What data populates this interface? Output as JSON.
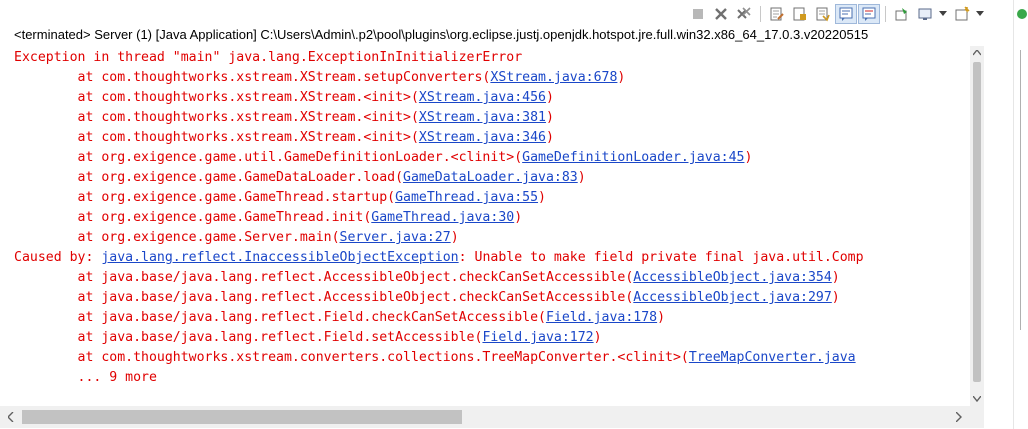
{
  "title": "<terminated> Server (1) [Java Application] C:\\Users\\Admin\\.p2\\pool\\plugins\\org.eclipse.justj.openjdk.hotspot.jre.full.win32.x86_64_17.0.3.v20220515",
  "toolbar": {
    "icons": [
      "terminate-icon",
      "remove-launch-icon",
      "remove-all-terminated-icon",
      "clear-console-icon",
      "scroll-lock-icon",
      "word-wrap-icon",
      "show-on-stdout-icon",
      "show-on-stderr-icon",
      "pin-console-icon",
      "display-console-icon",
      "open-console-icon"
    ]
  },
  "console": {
    "lines": [
      {
        "text": "Exception in thread \"main\" java.lang.ExceptionInInitializerError",
        "link": "",
        "suffix": ""
      },
      {
        "text": "        at com.thoughtworks.xstream.XStream.setupConverters(",
        "link": "XStream.java:678",
        "suffix": ")"
      },
      {
        "text": "        at com.thoughtworks.xstream.XStream.<init>(",
        "link": "XStream.java:456",
        "suffix": ")"
      },
      {
        "text": "        at com.thoughtworks.xstream.XStream.<init>(",
        "link": "XStream.java:381",
        "suffix": ")"
      },
      {
        "text": "        at com.thoughtworks.xstream.XStream.<init>(",
        "link": "XStream.java:346",
        "suffix": ")"
      },
      {
        "text": "        at org.exigence.game.util.GameDefinitionLoader.<clinit>(",
        "link": "GameDefinitionLoader.java:45",
        "suffix": ")"
      },
      {
        "text": "        at org.exigence.game.GameDataLoader.load(",
        "link": "GameDataLoader.java:83",
        "suffix": ")"
      },
      {
        "text": "        at org.exigence.game.GameThread.startup(",
        "link": "GameThread.java:55",
        "suffix": ")"
      },
      {
        "text": "        at org.exigence.game.GameThread.init(",
        "link": "GameThread.java:30",
        "suffix": ")"
      },
      {
        "text": "        at org.exigence.game.Server.main(",
        "link": "Server.java:27",
        "suffix": ")"
      },
      {
        "text": "Caused by: ",
        "link": "java.lang.reflect.InaccessibleObjectException",
        "suffix": ": Unable to make field private final java.util.Comp"
      },
      {
        "text": "        at java.base/java.lang.reflect.AccessibleObject.checkCanSetAccessible(",
        "link": "AccessibleObject.java:354",
        "suffix": ")"
      },
      {
        "text": "        at java.base/java.lang.reflect.AccessibleObject.checkCanSetAccessible(",
        "link": "AccessibleObject.java:297",
        "suffix": ")"
      },
      {
        "text": "        at java.base/java.lang.reflect.Field.checkCanSetAccessible(",
        "link": "Field.java:178",
        "suffix": ")"
      },
      {
        "text": "        at java.base/java.lang.reflect.Field.setAccessible(",
        "link": "Field.java:172",
        "suffix": ")"
      },
      {
        "text": "        at com.thoughtworks.xstream.converters.collections.TreeMapConverter.<clinit>(",
        "link": "TreeMapConverter.java",
        "suffix": ""
      },
      {
        "text": "        ... 9 more",
        "link": "",
        "suffix": ""
      }
    ]
  },
  "colors": {
    "error": "#e00000",
    "link": "#1a47c8"
  }
}
